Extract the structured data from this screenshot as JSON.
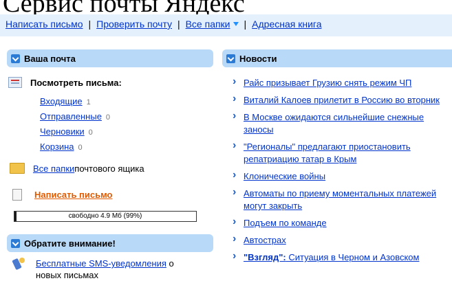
{
  "page_title": "Сервис почты Яндекс",
  "topnav": {
    "write": "Написать письмо",
    "check": "Проверить почту",
    "all_folders": "Все папки",
    "address_book": "Адресная книга"
  },
  "mail_panel": {
    "title": "Ваша почта",
    "view_label": "Посмотреть письма:",
    "folders": [
      {
        "name": "Входящие",
        "count": "1"
      },
      {
        "name": "Отправленные",
        "count": "0"
      },
      {
        "name": "Черновики",
        "count": "0"
      },
      {
        "name": "Корзина",
        "count": "0"
      }
    ],
    "all_folders_link": "Все папки",
    "all_folders_suffix": " почтового ящика",
    "write_link": "Написать письмо",
    "quota_text": "свободно 4.9 Мб (99%)",
    "quota_used_percent": 1
  },
  "attention_panel": {
    "title": "Обратите внимание!",
    "sms_link": "Бесплатные SMS-уведомления",
    "sms_suffix": " о новых письмах"
  },
  "news_panel": {
    "title": "Новости",
    "items": [
      {
        "text": "Райс призывает Грузию снять режим ЧП"
      },
      {
        "text": "Виталий Калоев прилетит в Россию во вторник"
      },
      {
        "text": "В Москве ожидаются сильнейшие снежные заносы"
      },
      {
        "text": "\"Регионалы\" предлагают приостановить репатриацию татар в Крым"
      },
      {
        "text": "Клонические войны"
      },
      {
        "text": "Автоматы по приему моментальных платежей могут закрыть"
      },
      {
        "text": "Подъем по команде"
      },
      {
        "text": "Автострах"
      },
      {
        "quote": "\"Взгляд\":",
        "text": " Ситуация в Черном и Азовском"
      }
    ]
  }
}
